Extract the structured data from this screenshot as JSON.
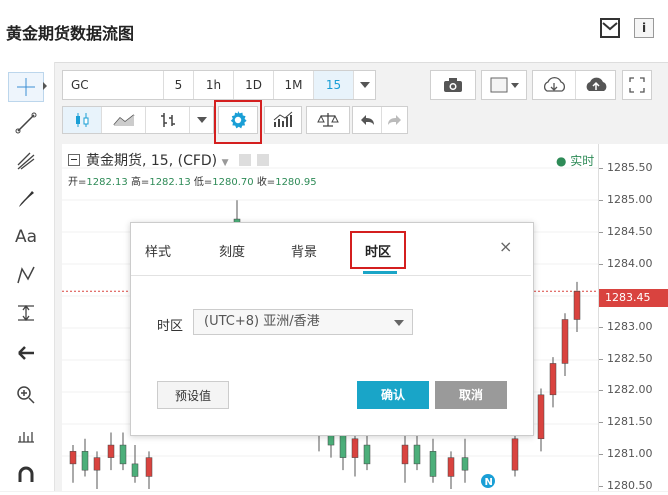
{
  "page": {
    "title": "黄金期货数据流图"
  },
  "toolbar": {
    "symbol": "GC",
    "intervals": [
      "5",
      "1h",
      "1D",
      "1M",
      "15"
    ],
    "active_interval": "15"
  },
  "legend": {
    "title": "黄金期货, 15, (CFD)",
    "open_label": "开=",
    "open": "1282.13",
    "high_label": "高=",
    "high": "1282.13",
    "low_label": "低=",
    "low": "1280.70",
    "close_label": "收=",
    "close": "1280.95",
    "realtime": "● 实时"
  },
  "price_axis": {
    "labels": [
      "1285.50",
      "1285.00",
      "1284.50",
      "1284.00",
      "1283.00",
      "1282.50",
      "1282.00",
      "1281.50",
      "1281.00",
      "1280.50"
    ],
    "last_price": "1283.45"
  },
  "chart_data": {
    "type": "candlestick",
    "ylim": [
      1280.3,
      1285.7
    ],
    "candles": [
      {
        "o": 1280.7,
        "h": 1281.0,
        "l": 1280.4,
        "c": 1280.9
      },
      {
        "o": 1280.9,
        "h": 1281.1,
        "l": 1280.5,
        "c": 1280.6
      },
      {
        "o": 1280.6,
        "h": 1280.9,
        "l": 1280.3,
        "c": 1280.8
      },
      {
        "o": 1280.8,
        "h": 1281.2,
        "l": 1280.6,
        "c": 1281.0
      },
      {
        "o": 1281.0,
        "h": 1281.2,
        "l": 1280.6,
        "c": 1280.7
      },
      {
        "o": 1280.7,
        "h": 1281.0,
        "l": 1280.4,
        "c": 1280.5
      },
      {
        "o": 1280.5,
        "h": 1280.9,
        "l": 1280.3,
        "c": 1280.8
      },
      {
        "o": 1284.6,
        "h": 1284.9,
        "l": 1284.2,
        "c": 1284.4
      },
      {
        "o": 1281.3,
        "h": 1281.6,
        "l": 1280.9,
        "c": 1281.5
      },
      {
        "o": 1281.3,
        "h": 1281.6,
        "l": 1280.8,
        "c": 1281.0
      },
      {
        "o": 1281.2,
        "h": 1281.4,
        "l": 1280.6,
        "c": 1280.8
      },
      {
        "o": 1280.8,
        "h": 1281.3,
        "l": 1280.5,
        "c": 1281.1
      },
      {
        "o": 1281.0,
        "h": 1281.3,
        "l": 1280.6,
        "c": 1280.7
      },
      {
        "o": 1280.7,
        "h": 1281.2,
        "l": 1280.4,
        "c": 1281.0
      },
      {
        "o": 1281.0,
        "h": 1281.3,
        "l": 1280.6,
        "c": 1280.7
      },
      {
        "o": 1280.9,
        "h": 1281.1,
        "l": 1280.4,
        "c": 1280.5
      },
      {
        "o": 1280.5,
        "h": 1280.9,
        "l": 1280.3,
        "c": 1280.8
      },
      {
        "o": 1280.8,
        "h": 1281.1,
        "l": 1280.4,
        "c": 1280.6
      },
      {
        "o": 1280.6,
        "h": 1281.2,
        "l": 1280.5,
        "c": 1281.1
      },
      {
        "o": 1281.1,
        "h": 1281.9,
        "l": 1280.9,
        "c": 1281.8
      },
      {
        "o": 1281.8,
        "h": 1282.4,
        "l": 1281.6,
        "c": 1282.3
      },
      {
        "o": 1282.3,
        "h": 1283.1,
        "l": 1282.1,
        "c": 1283.0
      },
      {
        "o": 1283.0,
        "h": 1283.6,
        "l": 1282.8,
        "c": 1283.45
      }
    ]
  },
  "modal": {
    "tabs": [
      "样式",
      "刻度",
      "背景",
      "时区"
    ],
    "active_tab": "时区",
    "close": "×",
    "timezone_label": "时区",
    "timezone_value": "(UTC+8) 亚洲/香港",
    "default_button": "预设值",
    "ok_button": "确认",
    "cancel_button": "取消"
  },
  "left_toolbar_text": "Aa",
  "n_badge": "N",
  "colors": {
    "up": "#d9433f",
    "down": "#4caf7a",
    "accent": "#1aa5c7",
    "highlight": "#d41f1f"
  }
}
